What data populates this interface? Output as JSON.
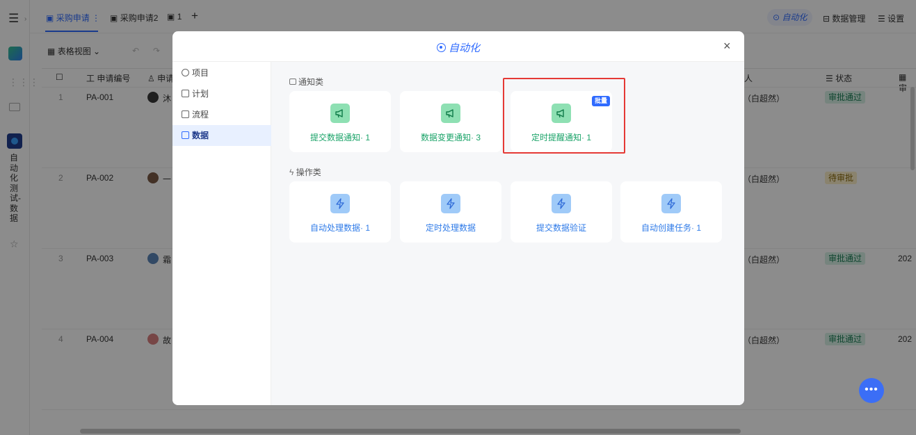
{
  "topbar": {
    "tabs": [
      {
        "label": "采购申请",
        "active": true
      },
      {
        "label": "采购申请2",
        "active": false
      },
      {
        "label": "1",
        "active": false
      }
    ],
    "automation_label": "自动化",
    "data_mgmt_label": "数据管理",
    "settings_label": "设置"
  },
  "left_rail": {
    "app_label": "自动化测试-数据"
  },
  "toolbar": {
    "view_label": "表格视图"
  },
  "table": {
    "headers": {
      "code": "申请编号",
      "applicant": "申请",
      "person": "人",
      "status": "状态",
      "last": "审"
    },
    "rows": [
      {
        "index": "1",
        "code": "PA-001",
        "name": "沐",
        "person": "（白超然）",
        "status": "审批通过",
        "status_type": "ok",
        "extra": ""
      },
      {
        "index": "2",
        "code": "PA-002",
        "name": "一",
        "person": "（白超然）",
        "status": "待审批",
        "status_type": "wait",
        "extra": ""
      },
      {
        "index": "3",
        "code": "PA-003",
        "name": "霜",
        "person": "（白超然）",
        "status": "审批通过",
        "status_type": "ok",
        "extra": "202"
      },
      {
        "index": "4",
        "code": "PA-004",
        "name": "故",
        "person": "（白超然）",
        "status": "审批通过",
        "status_type": "ok",
        "extra": "202"
      }
    ]
  },
  "fab": {
    "label": "•••"
  },
  "modal": {
    "title": "自动化",
    "close": "×",
    "sidebar": [
      {
        "label": "项目",
        "active": false
      },
      {
        "label": "计划",
        "active": false
      },
      {
        "label": "流程",
        "active": false
      },
      {
        "label": "数据",
        "active": true
      }
    ],
    "sections": [
      {
        "title": "通知类",
        "cards": [
          {
            "label": "提交数据通知· 1",
            "color": "green",
            "badge": ""
          },
          {
            "label": "数据变更通知· 3",
            "color": "green",
            "badge": ""
          },
          {
            "label": "定时提醒通知· 1",
            "color": "green",
            "badge": "批量"
          }
        ]
      },
      {
        "title": "操作类",
        "cards": [
          {
            "label": "自动处理数据· 1",
            "color": "blue",
            "badge": ""
          },
          {
            "label": "定时处理数据",
            "color": "blue",
            "badge": ""
          },
          {
            "label": "提交数据验证",
            "color": "blue",
            "badge": ""
          },
          {
            "label": "自动创建任务· 1",
            "color": "blue",
            "badge": ""
          }
        ]
      }
    ]
  },
  "colors": {
    "accent": "#2f6bff",
    "notify_green": "#1aa368",
    "action_blue": "#2f7be8",
    "highlight_red": "#e53935"
  }
}
